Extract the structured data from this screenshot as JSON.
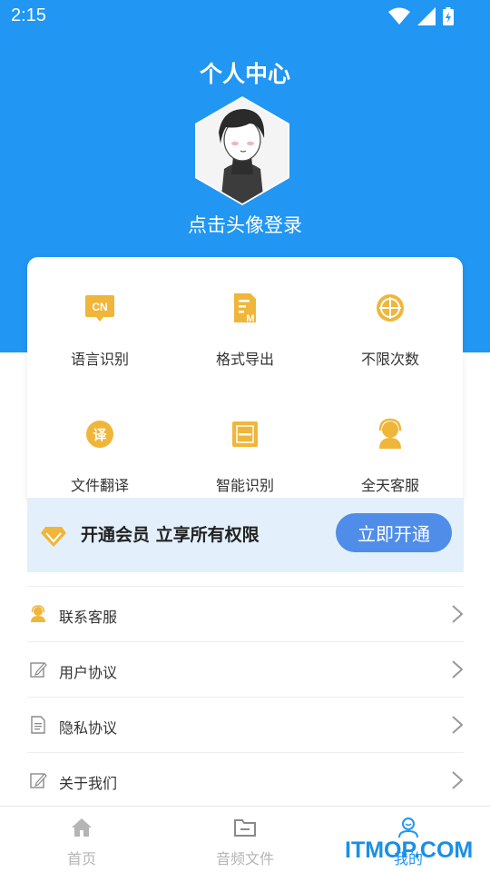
{
  "status": {
    "time": "2:15"
  },
  "header": {
    "title": "个人中心",
    "login_text": "点击头像登录"
  },
  "features": [
    {
      "label": "语言识别",
      "icon": "cn-language-icon",
      "glyph": "CN"
    },
    {
      "label": "格式导出",
      "icon": "export-format-icon",
      "glyph": "M"
    },
    {
      "label": "不限次数",
      "icon": "unlimited-icon",
      "glyph": ""
    },
    {
      "label": "文件翻译",
      "icon": "translate-icon",
      "glyph": "译"
    },
    {
      "label": "智能识别",
      "icon": "scan-icon",
      "glyph": ""
    },
    {
      "label": "全天客服",
      "icon": "support-icon",
      "glyph": ""
    }
  ],
  "vip": {
    "text": "开通会员 立享所有权限",
    "button": "立即开通"
  },
  "menu": [
    {
      "label": "联系客服",
      "icon": "customer-service-icon"
    },
    {
      "label": "用户协议",
      "icon": "edit-document-icon"
    },
    {
      "label": "隐私协议",
      "icon": "document-icon"
    },
    {
      "label": "关于我们",
      "icon": "edit-document-icon"
    }
  ],
  "tabs": [
    {
      "label": "首页",
      "icon": "home-icon"
    },
    {
      "label": "音频文件",
      "icon": "folder-icon"
    },
    {
      "label": "我的",
      "icon": "profile-icon",
      "active": true
    }
  ],
  "watermark": "ITMOP.COM",
  "colors": {
    "primary": "#2196f3",
    "gold": "#f0b63a",
    "vip_bg": "#e3f0fc",
    "vip_button": "#4f8de8"
  }
}
